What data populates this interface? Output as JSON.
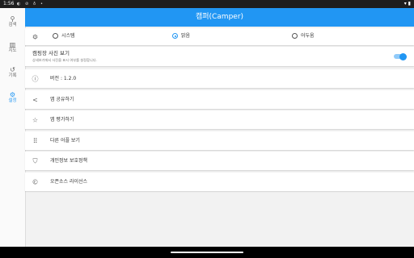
{
  "status_bar": {
    "time": "1:56",
    "left_icons": "◐ ⊘ ♁ •",
    "right_icons": "▾ ▮"
  },
  "rail": {
    "items": [
      {
        "icon": "search-icon",
        "glyph": "⚲",
        "label": "검색",
        "active": false
      },
      {
        "icon": "map-icon",
        "glyph": "▥",
        "label": "지도",
        "active": false
      },
      {
        "icon": "history-icon",
        "glyph": "↺",
        "label": "기록",
        "active": false
      },
      {
        "icon": "settings-icon",
        "glyph": "⚙",
        "label": "설정",
        "active": true
      }
    ]
  },
  "app_bar": {
    "title": "캠퍼(Camper)"
  },
  "theme": {
    "icon": "settings-outline-icon",
    "glyph": "⚙",
    "options": [
      {
        "label": "시스템",
        "checked": false
      },
      {
        "label": "밝음",
        "checked": true
      },
      {
        "label": "어두움",
        "checked": false
      }
    ]
  },
  "photo_setting": {
    "title": "캠핑장 사진 보기",
    "description": "상세보기에서 사진을 표시 여부를 설정합니다.",
    "enabled": true
  },
  "menu": [
    {
      "icon": "info-icon",
      "glyph": "ⓘ",
      "label": "버전 : 1.2.0"
    },
    {
      "icon": "share-icon",
      "glyph": "<",
      "label": "앱 공유하기"
    },
    {
      "icon": "star-icon",
      "glyph": "☆",
      "label": "앱 평가하기"
    },
    {
      "icon": "apps-grid-icon",
      "glyph": "⠿",
      "label": "다른 어플 보기"
    },
    {
      "icon": "shield-icon",
      "glyph": "⛉",
      "label": "개인정보 보호정책"
    },
    {
      "icon": "copyright-icon",
      "glyph": "©",
      "label": "오픈소스 라이선스"
    }
  ],
  "colors": {
    "accent": "#2196f3",
    "toggle_track": "#90caf9",
    "background": "#f2f2f2",
    "card": "#ffffff"
  }
}
